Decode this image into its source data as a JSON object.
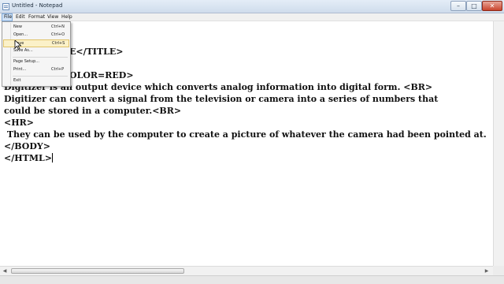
{
  "window": {
    "title": "Untitled - Notepad",
    "controls": {
      "minimize": "–",
      "maximize": "□",
      "close": "✕"
    }
  },
  "menubar": {
    "items": [
      "File",
      "Edit",
      "Format",
      "View",
      "Help"
    ]
  },
  "file_menu": {
    "items": [
      {
        "label": "New",
        "shortcut": "Ctrl+N"
      },
      {
        "label": "Open...",
        "shortcut": "Ctrl+O"
      },
      {
        "label": "Save",
        "shortcut": "Ctrl+S"
      },
      {
        "label": "Save As...",
        "shortcut": ""
      },
      {
        "label": "Page Setup...",
        "shortcut": ""
      },
      {
        "label": "Print...",
        "shortcut": "Ctrl+P"
      },
      {
        "label": "Exit",
        "shortcut": ""
      }
    ],
    "highlighted": "Save"
  },
  "editor": {
    "visible_lines": [
      "",
      "E</TITLE>",
      "",
      "OLOR=RED>",
      "Digitizer is an output device which converts analog information into digital form. <BR>",
      "Digitizer can convert a signal from the television or camera into a series of numbers that",
      "could be stored in a computer.<BR>",
      "<HR>",
      " They can be used by the computer to create a picture of whatever the camera had been pointed at.",
      "</BODY>",
      "</HTML>"
    ]
  },
  "scrollbars": {
    "left_arrow": "◀",
    "right_arrow": "▶"
  },
  "colors": {
    "titlebar": "#cfdcec",
    "menu_highlight": "#fbf1c8",
    "close_button": "#c9452d"
  }
}
